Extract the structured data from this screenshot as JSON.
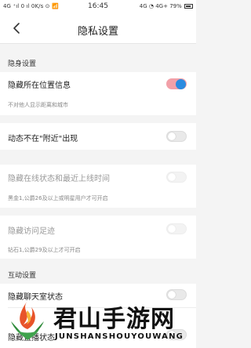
{
  "status_bar": {
    "left": "4G ⁺ıl 0 ıl 0K/s ⊙ 📶",
    "time": "16:45",
    "right": "4G ◔ 4G+ 79%",
    "battery": "battery-icon"
  },
  "nav": {
    "back_icon": "chevron-left-icon",
    "title": "隐私设置"
  },
  "sections": [
    {
      "header": "隐身设置",
      "items": [
        {
          "label": "隐藏所在位置信息",
          "note": "不对他人显示距离和城市",
          "on": true,
          "enabled": true
        },
        {
          "label": "动态不在\"附近\"出现",
          "note": "",
          "on": false,
          "enabled": true
        },
        {
          "label": "隐藏在线状态和最近上线时间",
          "note": "黑金1,公爵26及以上或明星用户才可开启",
          "on": false,
          "enabled": false
        },
        {
          "label": "隐藏访问足迹",
          "note": "钻石1,公爵29及以上才可开启",
          "on": false,
          "enabled": false
        }
      ]
    },
    {
      "header": "互动设置",
      "items": [
        {
          "label": "隐藏聊天室状态",
          "note": "",
          "on": false,
          "enabled": true
        },
        {
          "label": "隐藏直播状态",
          "note": "",
          "on": false,
          "enabled": true
        }
      ]
    }
  ],
  "watermark": {
    "title": "君山手游网",
    "subtitle": "JUNSHANSHOUYOUWANG",
    "logo": "flame-leaf-logo-icon"
  },
  "colors": {
    "toggle_on_track": "#f2a0a8",
    "toggle_on_knob": "#2b8be0",
    "toggle_off_track": "#e9e9e9",
    "background": "#f4f4f4"
  }
}
